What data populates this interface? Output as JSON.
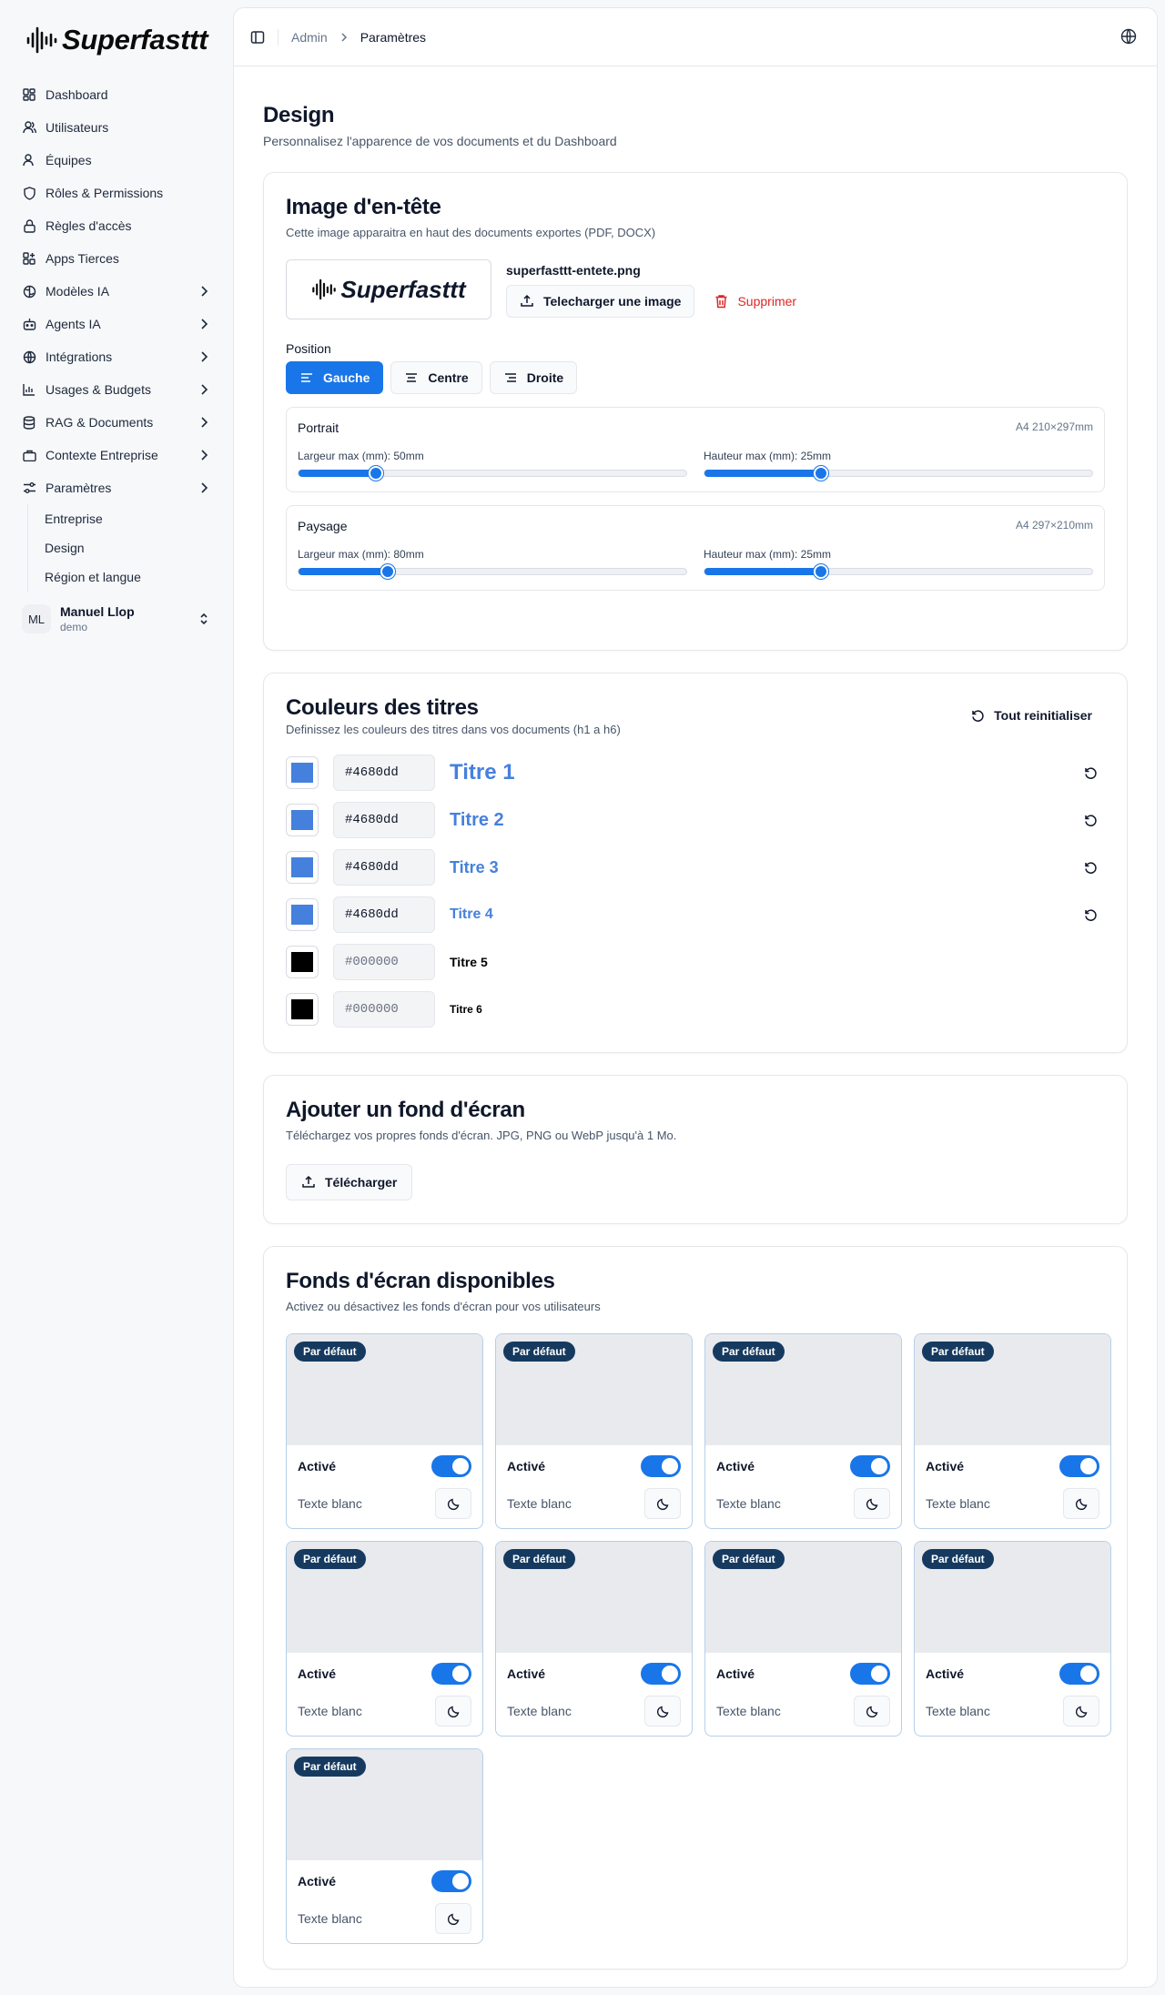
{
  "brand": {
    "name": "Superfasttt"
  },
  "sidebar": {
    "items": [
      {
        "label": "Dashboard",
        "icon": "dashboard-icon"
      },
      {
        "label": "Utilisateurs",
        "icon": "users-icon"
      },
      {
        "label": "Équipes",
        "icon": "team-icon"
      },
      {
        "label": "Rôles & Permissions",
        "icon": "shield-icon"
      },
      {
        "label": "Règles d'accès",
        "icon": "lock-icon"
      },
      {
        "label": "Apps Tierces",
        "icon": "apps-icon"
      },
      {
        "label": "Modèles IA",
        "icon": "brain-icon",
        "chevron": true
      },
      {
        "label": "Agents IA",
        "icon": "bot-icon",
        "chevron": true
      },
      {
        "label": "Intégrations",
        "icon": "plug-icon",
        "chevron": true
      },
      {
        "label": "Usages & Budgets",
        "icon": "chart-icon",
        "chevron": true
      },
      {
        "label": "RAG & Documents",
        "icon": "database-icon",
        "chevron": true
      },
      {
        "label": "Contexte Entreprise",
        "icon": "building-icon",
        "chevron": true
      },
      {
        "label": "Paramètres",
        "icon": "settings-icon",
        "chevron": true
      }
    ],
    "subitems": [
      "Entreprise",
      "Design",
      "Région et langue"
    ],
    "user": {
      "initials": "ML",
      "name": "Manuel Llop",
      "role": "demo"
    }
  },
  "topbar": {
    "crumb_root": "Admin",
    "crumb_current": "Paramètres"
  },
  "page": {
    "title": "Design",
    "subtitle": "Personnalisez l'apparence de vos documents et du Dashboard"
  },
  "header_image": {
    "title": "Image d'en-tête",
    "desc": "Cette image apparaitra en haut des documents exportes (PDF, DOCX)",
    "filename": "superfasttt-entete.png",
    "upload_label": "Telecharger une image",
    "delete_label": "Supprimer",
    "position_label": "Position",
    "positions": [
      "Gauche",
      "Centre",
      "Droite"
    ],
    "portrait": {
      "label": "Portrait",
      "format": "A4 210×297mm",
      "width_label": "Largeur max (mm): 50mm",
      "width_pct": 20,
      "height_label": "Hauteur max (mm): 25mm",
      "height_pct": 30
    },
    "paysage": {
      "label": "Paysage",
      "format": "A4 297×210mm",
      "width_label": "Largeur max (mm): 80mm",
      "width_pct": 23,
      "height_label": "Hauteur max (mm): 25mm",
      "height_pct": 30
    }
  },
  "title_colors": {
    "title": "Couleurs des titres",
    "desc": "Definissez les couleurs des titres dans vos documents (h1 a h6)",
    "reset_all_label": "Tout reinitialiser",
    "headings": [
      {
        "hex": "#4680dd",
        "label": "Titre 1",
        "color": "#4680dd"
      },
      {
        "hex": "#4680dd",
        "label": "Titre 2",
        "color": "#4680dd"
      },
      {
        "hex": "#4680dd",
        "label": "Titre 3",
        "color": "#4680dd"
      },
      {
        "hex": "#4680dd",
        "label": "Titre 4",
        "color": "#4680dd"
      },
      {
        "hex": "#000000",
        "label": "Titre 5",
        "color": "#000000"
      },
      {
        "hex": "#000000",
        "label": "Titre 6",
        "color": "#000000"
      }
    ]
  },
  "add_wallpaper": {
    "title": "Ajouter un fond d'écran",
    "desc": "Téléchargez vos propres fonds d'écran. JPG, PNG ou WebP jusqu'à 1 Mo.",
    "upload_label": "Télécharger"
  },
  "wallpapers": {
    "title": "Fonds d'écran disponibles",
    "desc": "Activez ou désactivez les fonds d'écran pour vos utilisateurs",
    "badge": "Par défaut",
    "active_label": "Activé",
    "text_label": "Texte blanc",
    "count": 9
  },
  "colors": {
    "accent": "#1976e8",
    "badge": "#163a5f",
    "danger": "#dc2626"
  }
}
